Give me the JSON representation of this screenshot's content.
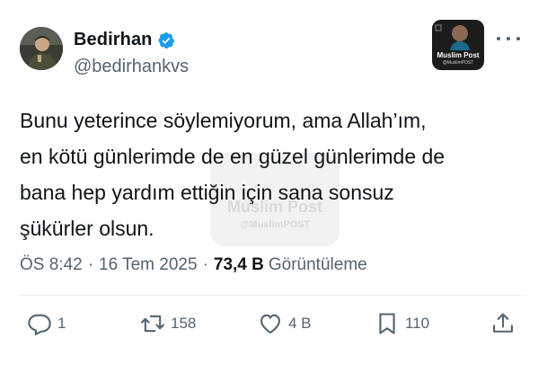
{
  "author": {
    "display_name": "Bedirhan",
    "handle": "@bedirhankvs",
    "verified": true,
    "verified_color": "#1d9bf0"
  },
  "watermark": {
    "title": "Muslim Post",
    "subtitle": "@MuslimPOST"
  },
  "tweet": {
    "text": "Bunu yeterince söylemiyorum, ama Allah’ım,\nen kötü günlerimde de en güzel günlerimde de\nbana hep yardım ettiğin için sana sonsuz\nşükürler olsun."
  },
  "meta": {
    "time": "ÖS 8:42",
    "separator": "·",
    "date": "16 Tem 2025",
    "views_count": "73,4 B",
    "views_label": "Görüntüleme"
  },
  "actions": {
    "reply_count": "1",
    "retweet_count": "158",
    "like_count": "4 B",
    "bookmark_count": "110"
  },
  "icons": [
    "verified-badge-icon",
    "more-icon",
    "reply-icon",
    "retweet-icon",
    "like-icon",
    "bookmark-icon",
    "share-icon"
  ],
  "colors": {
    "text": "#0f1419",
    "secondary": "#536471",
    "accent": "#1d9bf0"
  }
}
